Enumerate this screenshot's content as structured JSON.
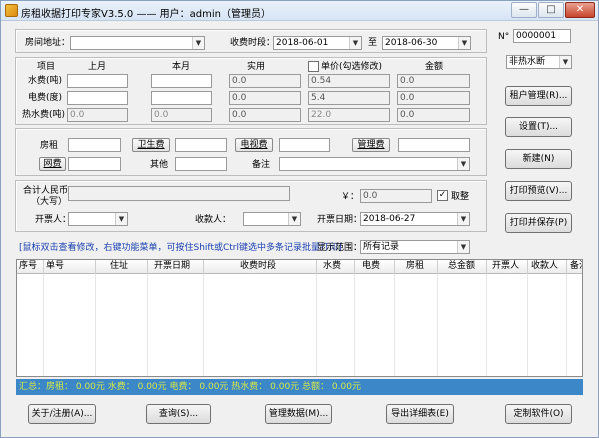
{
  "window": {
    "title": "房租收据打印专家V3.5.0 —— 用户：admin（管理员）"
  },
  "top": {
    "room_label": "房间地址：",
    "period_label": "收费时段：",
    "period_from": "2018-06-01",
    "to_label": "至",
    "period_to": "2018-06-30",
    "no_label": "N°",
    "no_value": "0000001",
    "water_type": "非热水断"
  },
  "meter": {
    "headers": [
      "项目",
      "上月",
      "本月",
      "实用",
      "单价(勾选修改)",
      "金额"
    ],
    "rows": [
      {
        "label": "水费(吨)",
        "last": "",
        "this": "",
        "used": "0.0",
        "price": "0.54",
        "amount": "0.0"
      },
      {
        "label": "电费(度)",
        "last": "",
        "this": "",
        "used": "0.0",
        "price": "5.4",
        "amount": "0.0"
      },
      {
        "label": "热水费(吨)",
        "last": "0.0",
        "this": "0.0",
        "used": "0.0",
        "price": "22.0",
        "amount": "0.0"
      }
    ]
  },
  "fees": {
    "rent": "房租",
    "sanitation": "卫生费",
    "tv": "电视费",
    "management": "管理费",
    "internet": "网费",
    "other": "其他",
    "remark": "备注"
  },
  "total": {
    "label_line1": "合计人民币",
    "label_line2": "（大写）",
    "yuan_symbol": "￥：",
    "amount": "0.0",
    "round_label": "取整",
    "round_checked": "✓",
    "issuer_label": "开票人：",
    "payee_label": "收款人：",
    "date_label": "开票日期：",
    "date_value": "2018-06-27"
  },
  "side_buttons": [
    "租户管理(R)...",
    "设置(T)...",
    "新建(N)",
    "打印预览(V)...",
    "打印并保存(P)"
  ],
  "list": {
    "hint": "[鼠标双击查看修改，右键功能菜单，可按住Shift或Ctrl键选中多条记录批量打印]",
    "range_label": "显示范围：",
    "range_value": "所有记录",
    "columns": [
      "序号",
      "单号",
      "住址",
      "开票日期",
      "收费时段",
      "水费",
      "电费",
      "房租",
      "总金额",
      "开票人",
      "收款人",
      "备注"
    ]
  },
  "summary": "汇总：房租： 0.00元   水费： 0.00元   电费： 0.00元   热水费： 0.00元   总额： 0.00元",
  "bottom_buttons": [
    "关于/注册(A)...",
    "查询(S)...",
    "管理数据(M)...",
    "导出详细表(E)",
    "定制软件(O)"
  ]
}
